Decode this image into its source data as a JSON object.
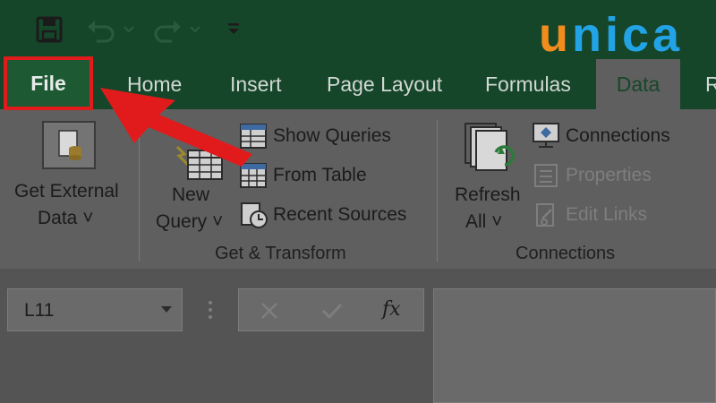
{
  "logo": {
    "text_u": "u",
    "text_rest": "nica"
  },
  "tabs": {
    "file": "File",
    "home": "Home",
    "insert": "Insert",
    "page_layout": "Page Layout",
    "formulas": "Formulas",
    "data": "Data",
    "review": "R"
  },
  "ribbon": {
    "get_external_data": {
      "line1": "Get External",
      "line2": "Data ˅"
    },
    "new_query": {
      "line1": "New",
      "line2": "Query ˅"
    },
    "show_queries": "Show Queries",
    "from_table": "From Table",
    "recent_sources": "Recent Sources",
    "group_get_transform": "Get & Transform",
    "refresh_all": {
      "line1": "Refresh",
      "line2": "All ˅"
    },
    "connections": "Connections",
    "properties": "Properties",
    "edit_links": "Edit Links",
    "group_connections": "Connections"
  },
  "formula_bar": {
    "name_box": "L11",
    "fx": "fx"
  },
  "colors": {
    "title_green": "#16462a",
    "highlight_red": "#e11b1b",
    "logo_orange": "#f28c1d",
    "logo_blue": "#22a3e6"
  }
}
